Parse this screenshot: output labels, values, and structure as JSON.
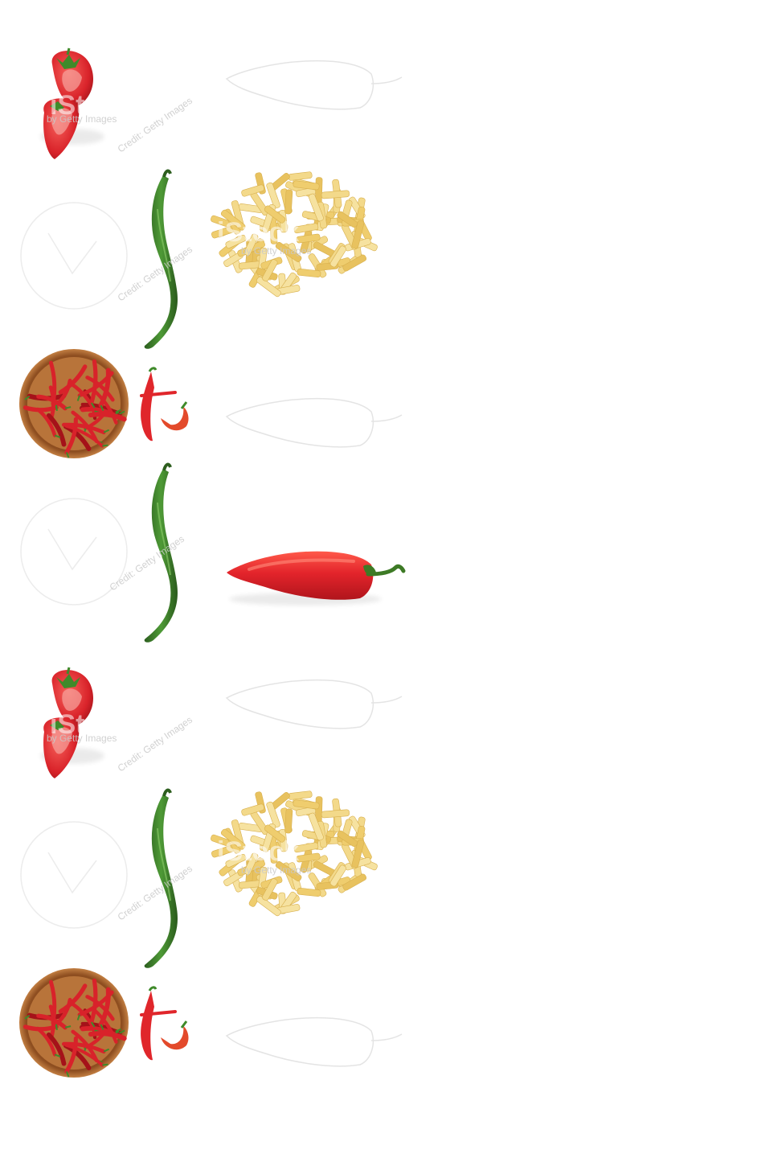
{
  "scene": {
    "background": "#ffffff",
    "tiles": [
      {
        "kind": "strawberry-halves-icon"
      },
      {
        "kind": "green-chili-icon"
      },
      {
        "kind": "penne-pasta-icon"
      },
      {
        "kind": "chili-bowl-icon"
      },
      {
        "kind": "red-chili-small-icon"
      },
      {
        "kind": "red-pepper-icon"
      }
    ],
    "colors": {
      "strawberry": "#d9232a",
      "green_chili": "#3b7a2a",
      "pasta": "#f1d27a",
      "bowl_wood": "#b8743a",
      "red_chili": "#e0262b",
      "ghost_outline": "#e4e4e4"
    }
  },
  "watermarks": {
    "brand_text": "iStock",
    "credit_text": "by Getty Images",
    "credit_text_alt": "Credit: Getty Images"
  }
}
